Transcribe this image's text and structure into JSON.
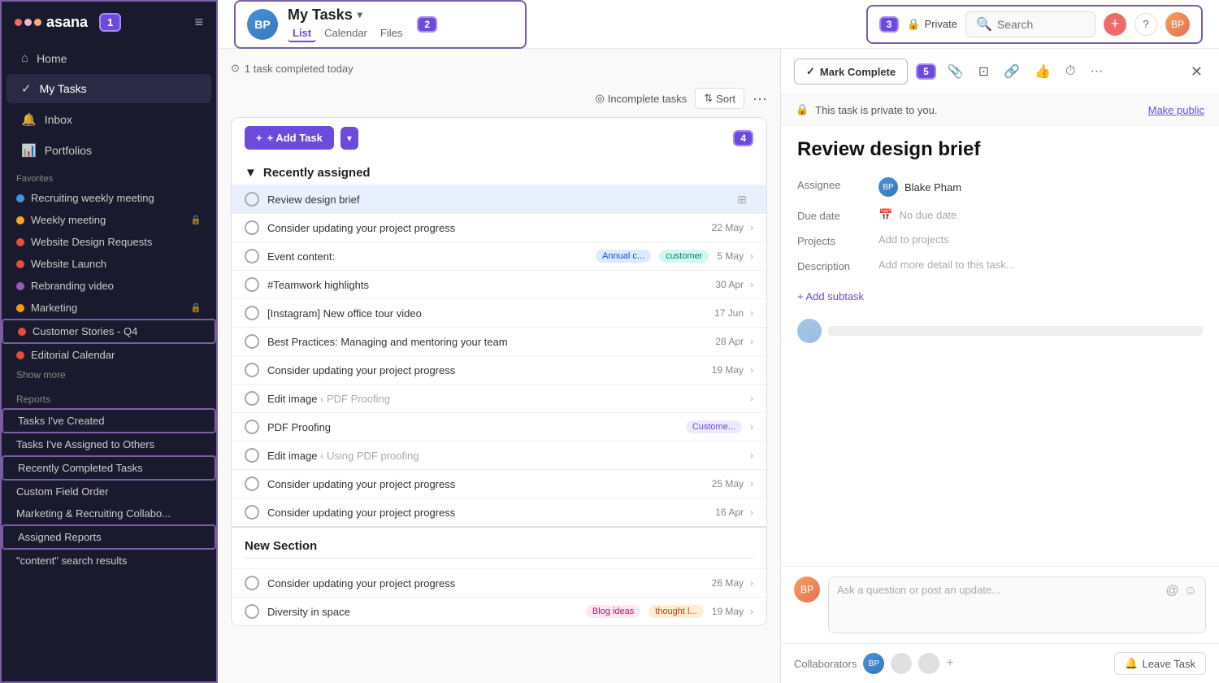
{
  "sidebar": {
    "logo_text": "asana",
    "badge1": "1",
    "nav_items": [
      {
        "id": "home",
        "icon": "⌂",
        "label": "Home"
      },
      {
        "id": "my-tasks",
        "icon": "✓",
        "label": "My Tasks",
        "active": true
      },
      {
        "id": "inbox",
        "icon": "🔔",
        "label": "Inbox"
      },
      {
        "id": "portfolios",
        "icon": "📊",
        "label": "Portfolios"
      }
    ],
    "favorites_title": "Favorites",
    "favorites": [
      {
        "id": "recruiting",
        "color": "#4a90d9",
        "label": "Recruiting weekly meeting"
      },
      {
        "id": "weekly",
        "color": "#f5a623",
        "label": "Weekly meeting",
        "lock": true
      },
      {
        "id": "website-design",
        "color": "#e74c3c",
        "label": "Website Design Requests"
      },
      {
        "id": "website-launch",
        "color": "#e74c3c",
        "label": "Website Launch"
      },
      {
        "id": "rebranding",
        "color": "#9b59b6",
        "label": "Rebranding video"
      },
      {
        "id": "marketing",
        "color": "#f39c12",
        "label": "Marketing",
        "lock": true
      },
      {
        "id": "customer-stories",
        "color": "#e74c3c",
        "label": "Customer Stories - Q4"
      },
      {
        "id": "editorial",
        "color": "#e74c3c",
        "label": "Editorial Calendar"
      }
    ],
    "show_more": "Show more",
    "reports_title": "Reports",
    "reports": [
      "Tasks I've Created",
      "Tasks I've Assigned to Others",
      "Recently Completed Tasks",
      "Custom Field Order",
      "Marketing & Recruiting Collabo...",
      "Assigned Reports",
      "\"content\" search results"
    ]
  },
  "header": {
    "avatar_initials": "BP",
    "my_tasks_title": "My Tasks",
    "tabs": [
      "List",
      "Calendar",
      "Files"
    ],
    "active_tab": "List",
    "badge2": "2",
    "completed_today": "1 task completed today",
    "badge3": "3",
    "private_label": "Private",
    "search_placeholder": "Search",
    "incomplete_tasks": "Incomplete tasks",
    "sort_label": "Sort"
  },
  "task_list": {
    "add_task_label": "+ Add Task",
    "badge4": "4",
    "recently_assigned": "Recently assigned",
    "tasks": [
      {
        "id": 1,
        "name": "Review design brief",
        "date": "",
        "selected": true
      },
      {
        "id": 2,
        "name": "Consider updating your project progress",
        "date": "22 May",
        "tags": []
      },
      {
        "id": 3,
        "name": "Event content:",
        "date": "5 May",
        "tags": [
          "Annual c...",
          "customer"
        ],
        "tag_colors": [
          "tag-blue",
          "tag-teal"
        ]
      },
      {
        "id": 4,
        "name": "#Teamwork highlights",
        "date": "30 Apr",
        "tags": []
      },
      {
        "id": 5,
        "name": "[Instagram] New office tour video",
        "date": "17 Jun",
        "tags": []
      },
      {
        "id": 6,
        "name": "Best Practices: Managing and mentoring your team",
        "date": "28 Apr",
        "tags": []
      },
      {
        "id": 7,
        "name": "Consider updating your project progress",
        "date": "19 May",
        "tags": []
      },
      {
        "id": 8,
        "name": "Edit image",
        "date": "",
        "tags": [],
        "subtag": "‹ PDF Proofing"
      },
      {
        "id": 9,
        "name": "PDF Proofing",
        "date": "",
        "tags": [
          "Custome..."
        ],
        "tag_colors": [
          "tag-purple"
        ]
      },
      {
        "id": 10,
        "name": "Edit image",
        "date": "",
        "tags": [],
        "subtag": "‹ Using PDF proofing"
      },
      {
        "id": 11,
        "name": "Consider updating your project progress",
        "date": "25 May",
        "tags": []
      },
      {
        "id": 12,
        "name": "Consider updating your project progress",
        "date": "16 Apr",
        "tags": []
      }
    ],
    "new_section": "New Section",
    "new_section_tasks": [
      {
        "id": 13,
        "name": "Consider updating your project progress",
        "date": "26 May",
        "tags": []
      },
      {
        "id": 14,
        "name": "Diversity in space",
        "date": "19 May",
        "tags": [
          "Blog ideas",
          "thought l..."
        ],
        "tag_colors": [
          "tag-pink",
          "tag-orange"
        ]
      }
    ]
  },
  "detail": {
    "badge5": "5",
    "mark_complete": "Mark Complete",
    "private_notice": "This task is private to you.",
    "make_public": "Make public",
    "title": "Review design brief",
    "assignee_label": "Assignee",
    "assignee_name": "Blake Pham",
    "due_date_label": "Due date",
    "due_date_value": "No due date",
    "projects_label": "Projects",
    "projects_value": "Add to projects",
    "description_label": "Description",
    "description_placeholder": "Add more detail to this task...",
    "add_subtask": "+ Add subtask",
    "comment_placeholder": "Ask a question or post an update...",
    "collaborators_label": "Collaborators",
    "leave_task": "Leave Task"
  }
}
